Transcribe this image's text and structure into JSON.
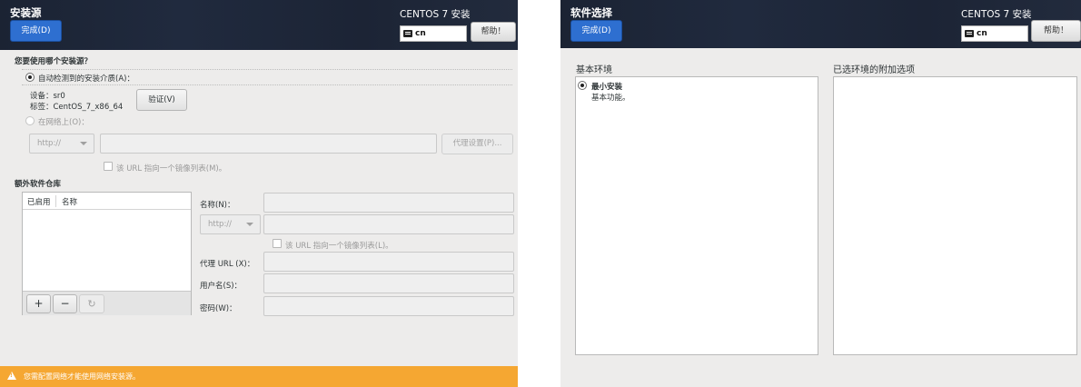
{
  "left": {
    "header": {
      "title": "安装源",
      "done_label": "完成(D)",
      "install_title": "CENTOS 7 安装",
      "keyboard": "cn",
      "help_label": "帮助！"
    },
    "question": "您要使用哪个安装源？",
    "auto_detect_label": "自动检测到的安装介质(A)：",
    "device_label": "设备：sr0",
    "tag_label": "标签：CentOS_7_x86_64",
    "verify_label": "验证(V)",
    "network_label": "在网络上(O)：",
    "protocol_value": "http://",
    "proxy_label": "代理设置(P)...",
    "mirror_list_label": "该 URL 指向一个镜像列表(M)。",
    "extra_repo_title": "额外软件仓库",
    "repo_columns": [
      "已启用",
      "名称"
    ],
    "add_label": "+",
    "remove_label": "−",
    "refresh_icon": "refresh-icon",
    "name_label": "名称(N)：",
    "repo_protocol_value": "http://",
    "repo_mirror_label": "该 URL 指向一个镜像列表(L)。",
    "proxy_url_label": "代理 URL (X)：",
    "username_label": "用户名(S)：",
    "password_label": "密码(W)：",
    "warning_text": "您需配置网络才能使用网络安装源。",
    "warning_color": "#f5a732"
  },
  "right": {
    "header": {
      "title": "软件选择",
      "done_label": "完成(D)",
      "install_title": "CENTOS 7 安装",
      "keyboard": "cn",
      "help_label": "帮助！"
    },
    "base_env_title": "基本环境",
    "addons_title": "已选环境的附加选项",
    "environments": [
      {
        "name": "最小安装",
        "description": "基本功能。",
        "selected": true
      }
    ]
  },
  "colors": {
    "header_bg": "#1e273a",
    "accent": "#2e6fd0"
  }
}
